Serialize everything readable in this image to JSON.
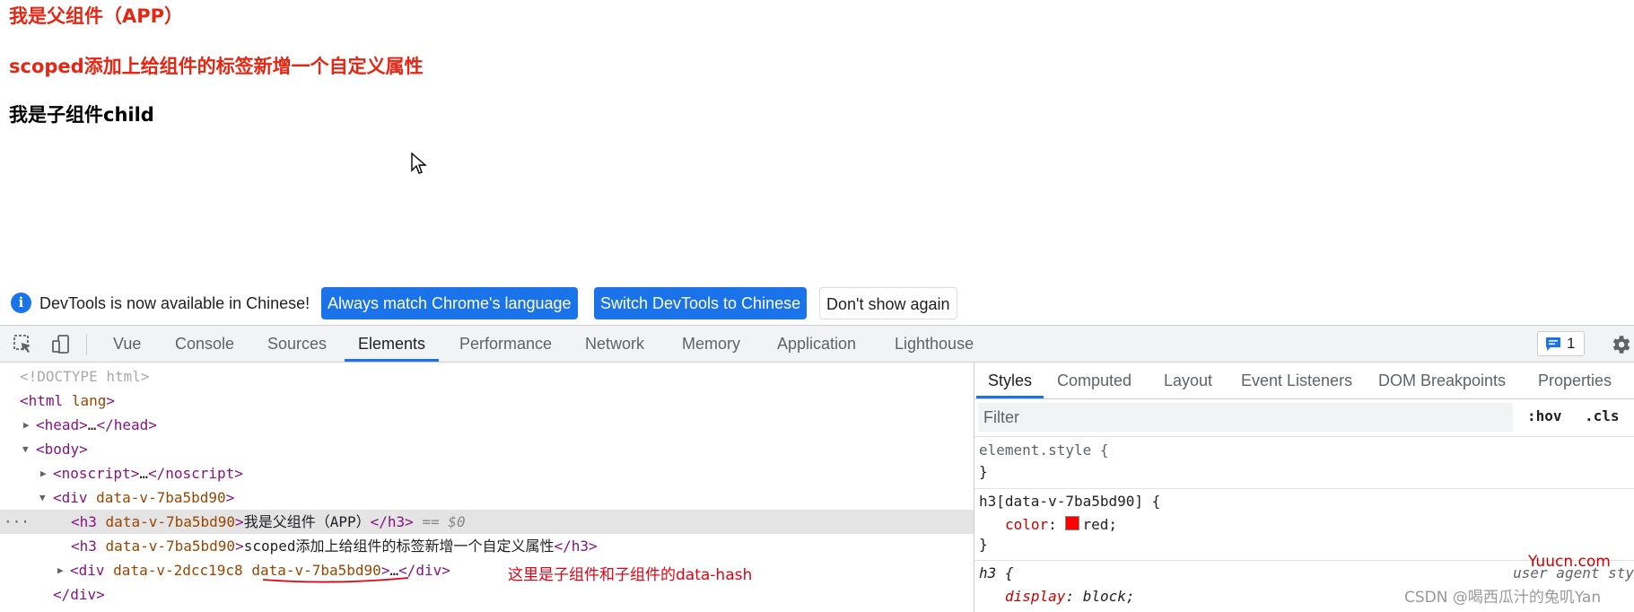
{
  "page": {
    "heading_app": "我是父组件（APP）",
    "heading_scoped": "scoped添加上给组件的标签新增一个自定义属性",
    "heading_child": "我是子组件child",
    "app_color": "#e62512"
  },
  "infobar": {
    "message": "DevTools is now available in Chinese!",
    "btn_match": "Always match Chrome's language",
    "btn_switch": "Switch DevTools to Chinese",
    "btn_dont_show": "Don't show again"
  },
  "toolbar": {
    "tabs": [
      "Vue",
      "Console",
      "Sources",
      "Elements",
      "Performance",
      "Network",
      "Memory",
      "Application",
      "Lighthouse"
    ],
    "active_tab": "Elements",
    "issues_count": "1"
  },
  "dom": {
    "doctype": "<!DOCTYPE html>",
    "html_open": "<html",
    "html_attr": "lang",
    "html_close": ">",
    "head_open": "<head>",
    "ellipsis": "…",
    "head_close": "</head>",
    "body": "<body>",
    "noscript_open": "<noscript>",
    "noscript_close": "</noscript>",
    "div_open": "<div",
    "attr_parent_hash": "data-v-7ba5bd90",
    "gt": ">",
    "h3_open": "<h3",
    "h3_close": "</h3>",
    "h3_1_text": "我是父组件（APP）",
    "eq_selected": "== $0",
    "h3_2_text": "scoped添加上给组件的标签新增一个自定义属性",
    "attr_child_hash": "data-v-2dcc19c8",
    "div_close": "</div>",
    "dots": "···"
  },
  "annotation": "这里是子组件和子组件的data-hash",
  "styles": {
    "tabs": [
      "Styles",
      "Computed",
      "Layout",
      "Event Listeners",
      "DOM Breakpoints",
      "Properties"
    ],
    "active_tab": "Styles",
    "filter_placeholder": "Filter",
    "hov": ":hov",
    "cls": ".cls",
    "element_style": "element.style {",
    "close_brace": "}",
    "rule_selector": "h3[data-v-7ba5bd90] {",
    "rule_prop": "color",
    "rule_value": "red;",
    "ua_selector": "h3 {",
    "ua_label": "user agent sty",
    "ua_prop": "display",
    "ua_value": "block;"
  },
  "watermarks": {
    "csdn": "CSDN @喝西瓜汁的兔叽Yan",
    "yuucn": "Yuucn.com"
  }
}
